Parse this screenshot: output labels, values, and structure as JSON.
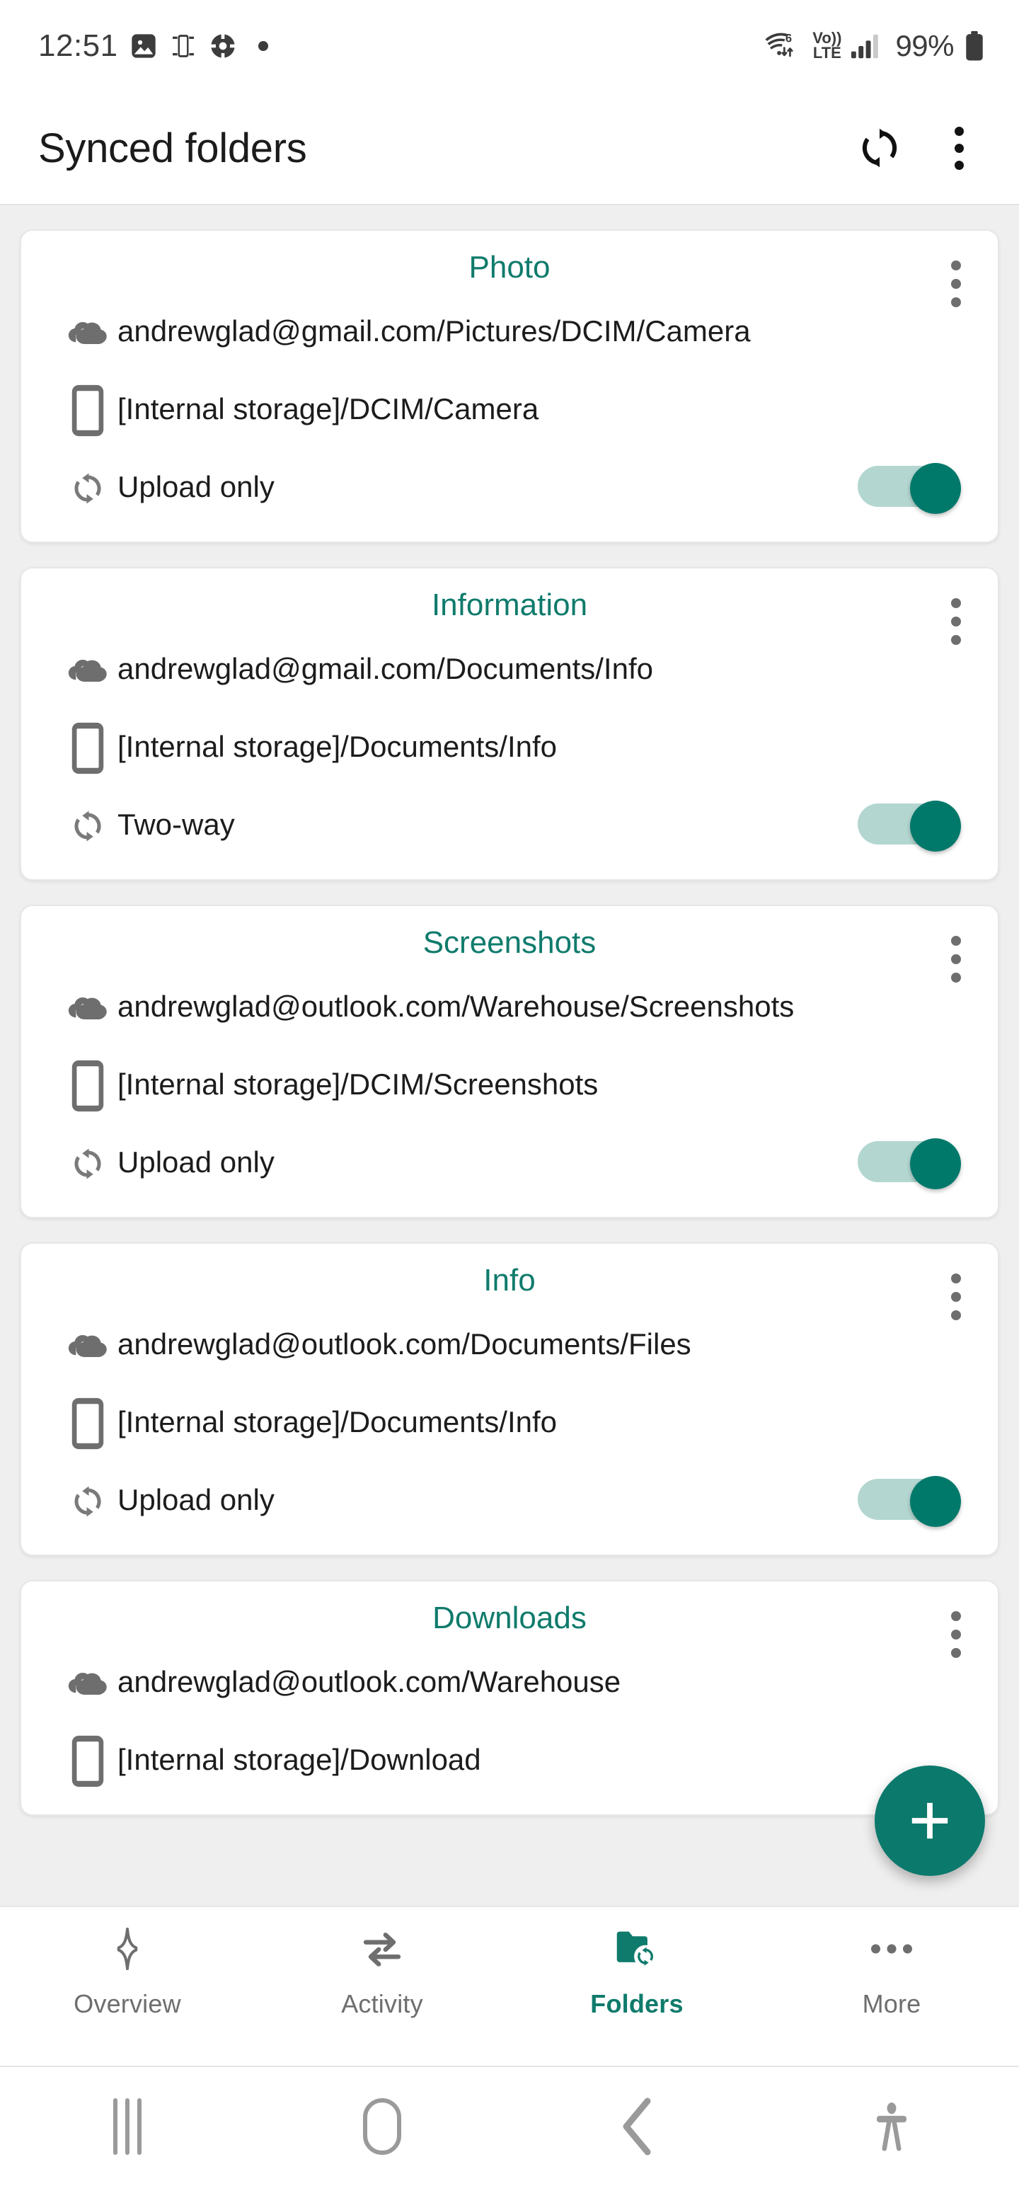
{
  "status_bar": {
    "clock": "12:51",
    "left_icons": [
      "image-icon",
      "screen-mirror-icon",
      "target-icon",
      "dot-icon"
    ],
    "wifi": {
      "icon": "wifi-icon",
      "generation": "6",
      "transfer": "up-down-arrows"
    },
    "network": {
      "line1": "Vo))",
      "line2": "LTE"
    },
    "signal": "signal-bars-icon",
    "battery_percent": "99%",
    "battery_icon": "battery-full-icon"
  },
  "header": {
    "title": "Synced folders",
    "sync_icon": "sync-icon",
    "overflow_icon": "kebab-menu-icon"
  },
  "colors": {
    "accent_teal": "#0F7B6C",
    "fab_teal": "#0B796C",
    "toggle_thumb": "#00796B",
    "toggle_track": "#B3D6D0",
    "page_bg": "#EFEFEF",
    "card_bg": "#FFFFFF",
    "text_primary": "#1C1C1C",
    "icon_gray": "#6E6E6E"
  },
  "icons": {
    "cloud": "cloud-icon",
    "device": "phone-device-icon",
    "sync_mode": "sync-arrows-icon",
    "card_menu": "kebab-menu-icon"
  },
  "folders": [
    {
      "title": "Photo",
      "remote": "andrewglad@gmail.com/Pictures/DCIM/Camera",
      "local": "[Internal storage]/DCIM/Camera",
      "mode": "Upload only",
      "enabled": true
    },
    {
      "title": "Information",
      "remote": "andrewglad@gmail.com/Documents/Info",
      "local": "[Internal storage]/Documents/Info",
      "mode": "Two-way",
      "enabled": true
    },
    {
      "title": "Screenshots",
      "remote": "andrewglad@outlook.com/Warehouse/Screenshots",
      "local": "[Internal storage]/DCIM/Screenshots",
      "mode": "Upload only",
      "enabled": true
    },
    {
      "title": "Info",
      "remote": "andrewglad@outlook.com/Documents/Files",
      "local": "[Internal storage]/Documents/Info",
      "mode": "Upload only",
      "enabled": true
    },
    {
      "title": "Downloads",
      "remote": "andrewglad@outlook.com/Warehouse",
      "local": "[Internal storage]/Download",
      "mode": "",
      "enabled": false
    }
  ],
  "fab": {
    "label": "+",
    "name": "add-folder-button"
  },
  "bottom_nav": {
    "items": [
      {
        "label": "Overview",
        "icon": "sparkle-icon",
        "active": false
      },
      {
        "label": "Activity",
        "icon": "transfer-arrows-icon",
        "active": false
      },
      {
        "label": "Folders",
        "icon": "folder-sync-icon",
        "active": true
      },
      {
        "label": "More",
        "icon": "ellipsis-icon",
        "active": false
      }
    ]
  },
  "system_nav": {
    "items": [
      {
        "name": "recents-button",
        "icon": "recents-icon"
      },
      {
        "name": "home-button",
        "icon": "home-icon"
      },
      {
        "name": "back-button",
        "icon": "back-chevron-icon"
      },
      {
        "name": "accessibility-button",
        "icon": "accessibility-icon"
      }
    ]
  }
}
